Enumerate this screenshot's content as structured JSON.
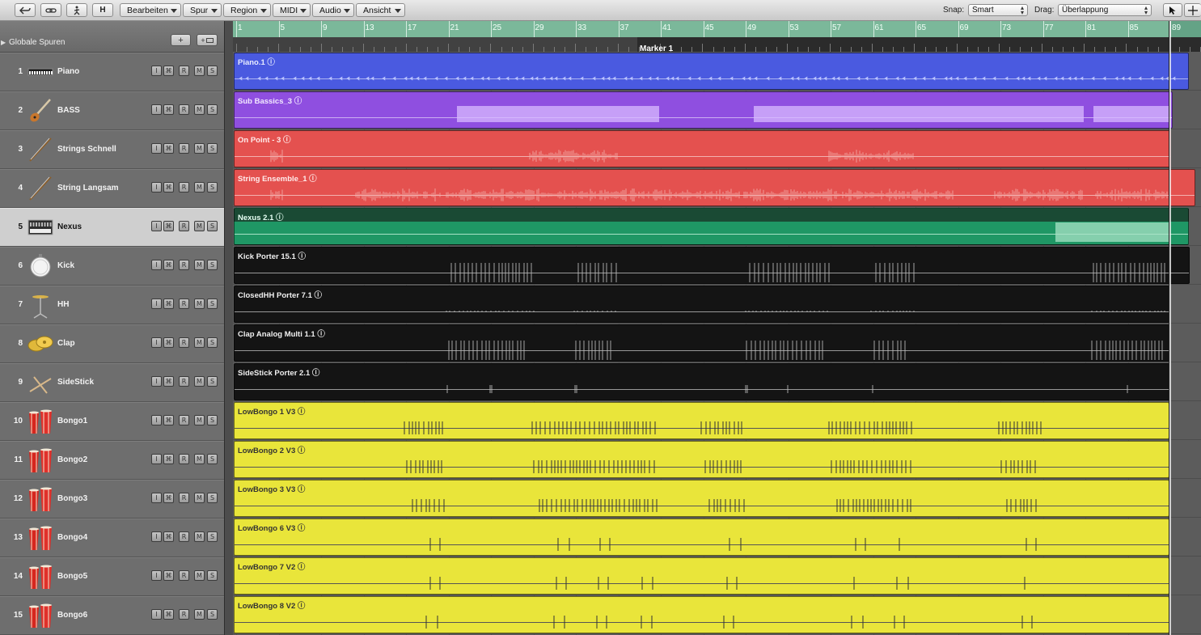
{
  "toolbar": {
    "menus": [
      {
        "label": "Bearbeiten"
      },
      {
        "label": "Spur"
      },
      {
        "label": "Region"
      },
      {
        "label": "MIDI"
      },
      {
        "label": "Audio"
      },
      {
        "label": "Ansicht"
      }
    ],
    "h_button": "H",
    "snap_label": "Snap:",
    "snap_value": "Smart",
    "drag_label": "Drag:",
    "drag_value": "Überlappung"
  },
  "track_header": {
    "global_tracks": "Globale Spuren",
    "add_button": "+",
    "folder_button": "+"
  },
  "ruler": {
    "bars": [
      "1",
      "5",
      "9",
      "13",
      "17",
      "21",
      "25",
      "29",
      "33",
      "37",
      "41",
      "45",
      "49",
      "53",
      "57",
      "61",
      "65",
      "69",
      "73",
      "77",
      "81",
      "85",
      "89"
    ],
    "marker": "Marker 1"
  },
  "track_buttons": [
    "I",
    "⌘",
    "R",
    "M",
    "S"
  ],
  "tracks": [
    {
      "num": "1",
      "name": "Piano",
      "icon": "keyboard-icon",
      "region": "Piano.1 ⓘ",
      "color": "#4a5ae0",
      "text": "#e8ecff"
    },
    {
      "num": "2",
      "name": "BASS",
      "icon": "bass-guitar-icon",
      "region": "Sub Bassics_3 ⓘ",
      "color": "#8f4fe0",
      "text": "#f3e9ff"
    },
    {
      "num": "3",
      "name": "Strings Schnell",
      "icon": "violin-bow-icon",
      "region": "On Point - 3 ⓘ",
      "color": "#e4514f",
      "text": "#ffeceb"
    },
    {
      "num": "4",
      "name": "String Langsam",
      "icon": "violin-bow-icon",
      "region": "String Ensemble_1 ⓘ",
      "color": "#e4514f",
      "text": "#ffeceb"
    },
    {
      "num": "5",
      "name": "Nexus",
      "icon": "synth-icon",
      "region": "Nexus 2.1 ⓘ",
      "color": "#1f9765",
      "text": "#e6fff3"
    },
    {
      "num": "6",
      "name": "Kick",
      "icon": "kick-drum-icon",
      "region": "Kick Porter 15.1 ⓘ",
      "color": "#141414",
      "text": "#f0f0f0"
    },
    {
      "num": "7",
      "name": "HH",
      "icon": "hihat-icon",
      "region": "ClosedHH Porter 7.1 ⓘ",
      "color": "#141414",
      "text": "#f0f0f0"
    },
    {
      "num": "8",
      "name": "Clap",
      "icon": "cymbal-icon",
      "region": "Clap Analog Multi 1.1 ⓘ",
      "color": "#141414",
      "text": "#f0f0f0"
    },
    {
      "num": "9",
      "name": "SideStick",
      "icon": "drumstick-icon",
      "region": "SideStick Porter 2.1 ⓘ",
      "color": "#141414",
      "text": "#f0f0f0"
    },
    {
      "num": "10",
      "name": "Bongo1",
      "icon": "bongo-icon",
      "region": "LowBongo 1 V3 ⓘ",
      "color": "#e9e53a",
      "text": "#333"
    },
    {
      "num": "11",
      "name": "Bongo2",
      "icon": "bongo-icon",
      "region": "LowBongo 2 V3 ⓘ",
      "color": "#e9e53a",
      "text": "#333"
    },
    {
      "num": "12",
      "name": "Bongo3",
      "icon": "bongo-icon",
      "region": "LowBongo 3 V3 ⓘ",
      "color": "#e9e53a",
      "text": "#333"
    },
    {
      "num": "13",
      "name": "Bongo4",
      "icon": "bongo-icon",
      "region": "LowBongo 6 V3 ⓘ",
      "color": "#e9e53a",
      "text": "#333"
    },
    {
      "num": "14",
      "name": "Bongo5",
      "icon": "bongo-icon",
      "region": "LowBongo 7 V2 ⓘ",
      "color": "#e9e53a",
      "text": "#333"
    },
    {
      "num": "15",
      "name": "Bongo6",
      "icon": "bongo-icon",
      "region": "LowBongo 8 V2 ⓘ",
      "color": "#e9e53a",
      "text": "#333"
    }
  ],
  "selected_track": "5"
}
